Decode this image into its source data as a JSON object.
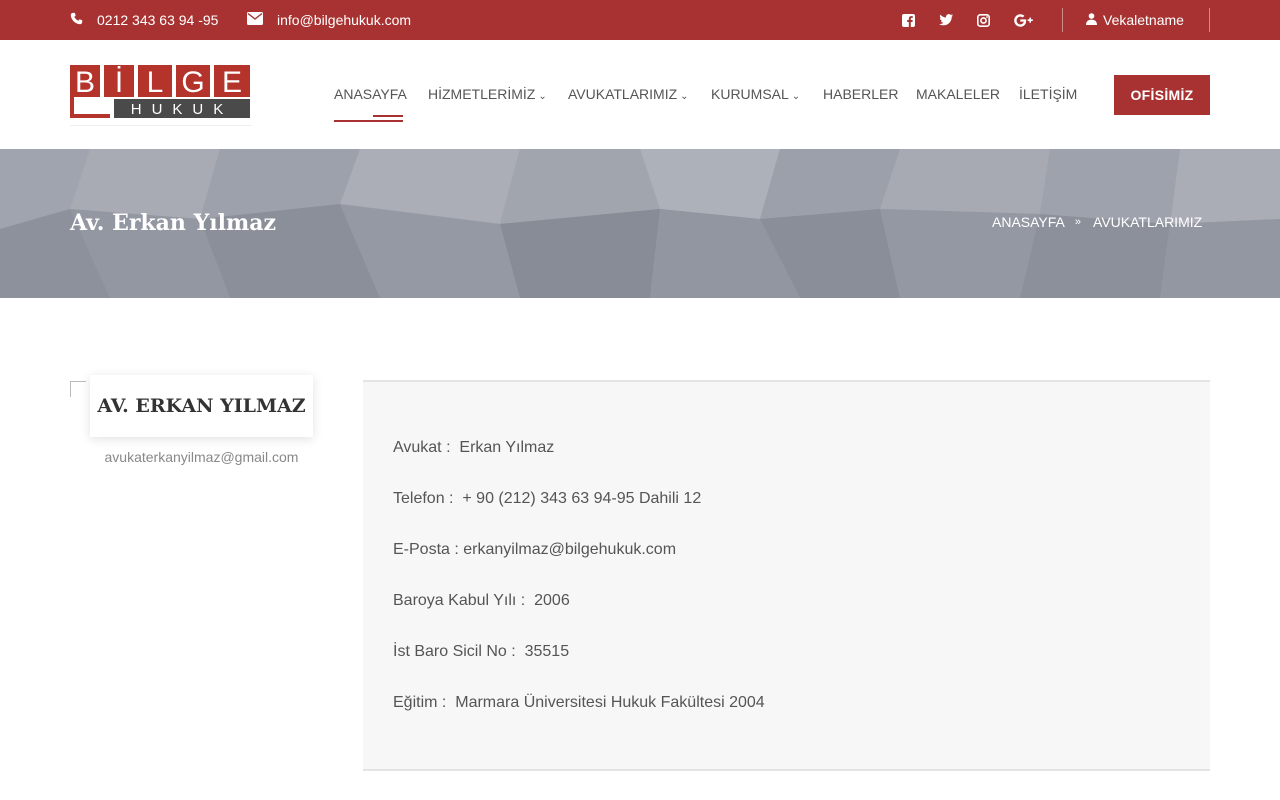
{
  "topbar": {
    "phone": "0212 343 63 94 -95",
    "email": "info@bilgehukuk.com",
    "social": [
      "facebook-icon",
      "twitter-icon",
      "instagram-icon",
      "google-plus-icon"
    ],
    "vekaletname": "Vekaletname"
  },
  "logo": {
    "top_text": "BİLGE",
    "bottom_text": "HUKUK"
  },
  "nav": {
    "items": [
      {
        "label": "ANASAYFA"
      },
      {
        "label": "HİZMETLERİMİZ"
      },
      {
        "label": "AVUKATLARIMIZ"
      },
      {
        "label": "KURUMSAL"
      },
      {
        "label": "HABERLER"
      },
      {
        "label": "MAKALELER"
      },
      {
        "label": "İLETİŞİM"
      }
    ],
    "button": "OFİSİMİZ"
  },
  "banner": {
    "title": "Av. Erkan Yılmaz",
    "breadcrumb": [
      "ANASAYFA",
      "AVUKATLARIMIZ"
    ]
  },
  "profile": {
    "name": "AV. ERKAN YILMAZ",
    "email": "avukaterkanyilmaz@gmail.com",
    "details": [
      "Avukat :  Erkan Yılmaz",
      "Telefon :  + 90 (212) 343 63 94-95 Dahili 12",
      "E-Posta : erkanyilmaz@bilgehukuk.com",
      "Baroya Kabul Yılı :  2006",
      "İst Baro Sicil No :  35515",
      "Eğitim :  Marmara Üniversitesi Hukuk Fakültesi 2004"
    ]
  },
  "colors": {
    "brand": "#a83232",
    "banner": "#9a9ea8"
  }
}
